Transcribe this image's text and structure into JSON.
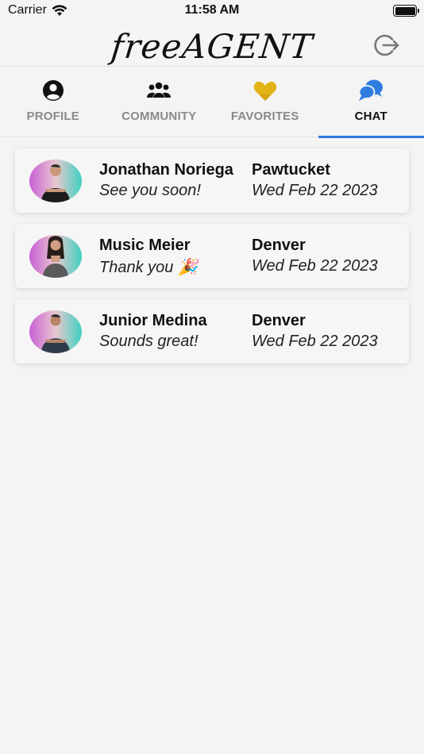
{
  "status_bar": {
    "carrier": "Carrier",
    "time": "11:58 AM"
  },
  "header": {
    "logo": "freeAGENT",
    "logout_icon": "logout-icon"
  },
  "tabs": [
    {
      "label": "PROFILE",
      "icon": "user-circle-icon",
      "active": false
    },
    {
      "label": "COMMUNITY",
      "icon": "group-icon",
      "active": false
    },
    {
      "label": "FAVORITES",
      "icon": "hearts-icon",
      "active": false
    },
    {
      "label": "CHAT",
      "icon": "chat-bubbles-icon",
      "active": true
    }
  ],
  "colors": {
    "accent": "#2f7ce0",
    "favorites": "#e2b315",
    "background": "#f4f4f4"
  },
  "chats": [
    {
      "name": "Jonathan Noriega",
      "message": "See you soon!",
      "city": "Pawtucket",
      "date": "Wed Feb 22 2023"
    },
    {
      "name": "Music Meier",
      "message": "Thank you 🎉",
      "city": "Denver",
      "date": "Wed Feb 22 2023"
    },
    {
      "name": "Junior Medina",
      "message": "Sounds great!",
      "city": "Denver",
      "date": "Wed Feb 22 2023"
    }
  ]
}
